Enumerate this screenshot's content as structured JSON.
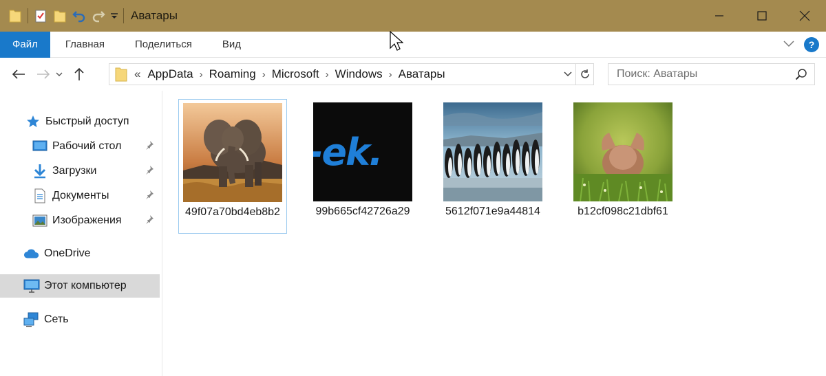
{
  "window": {
    "title": "Аватары"
  },
  "ribbon": {
    "tabs": [
      {
        "label": "Файл"
      },
      {
        "label": "Главная"
      },
      {
        "label": "Поделиться"
      },
      {
        "label": "Вид"
      }
    ],
    "help_label": "?"
  },
  "address": {
    "overflow": "«",
    "breadcrumbs": [
      "AppData",
      "Roaming",
      "Microsoft",
      "Windows",
      "Аватары"
    ]
  },
  "search": {
    "placeholder": "Поиск: Аватары"
  },
  "navpane": {
    "quick_access": "Быстрый доступ",
    "pinned": [
      {
        "label": "Рабочий стол",
        "icon": "desktop-icon"
      },
      {
        "label": "Загрузки",
        "icon": "downloads-icon"
      },
      {
        "label": "Документы",
        "icon": "documents-icon"
      },
      {
        "label": "Изображения",
        "icon": "pictures-icon"
      }
    ],
    "onedrive": "OneDrive",
    "this_pc": "Этот компьютер",
    "network": "Сеть"
  },
  "files": [
    {
      "name": "49f07a70bd4eb8b2",
      "thumbnail": "elephant"
    },
    {
      "name": "99b665cf42726a29",
      "thumbnail": "ek-logo"
    },
    {
      "name": "5612f071e9a44814",
      "thumbnail": "penguins"
    },
    {
      "name": "b12cf098c21dbf61",
      "thumbnail": "kitten-in-grass"
    }
  ],
  "thumbnail_text": {
    "ek_logo": "-ek."
  },
  "colors": {
    "titlebar": "#a48a4f",
    "file_tab": "#1979ca",
    "selection_border": "#99c9ef",
    "nav_selected": "#d9d9d9"
  }
}
